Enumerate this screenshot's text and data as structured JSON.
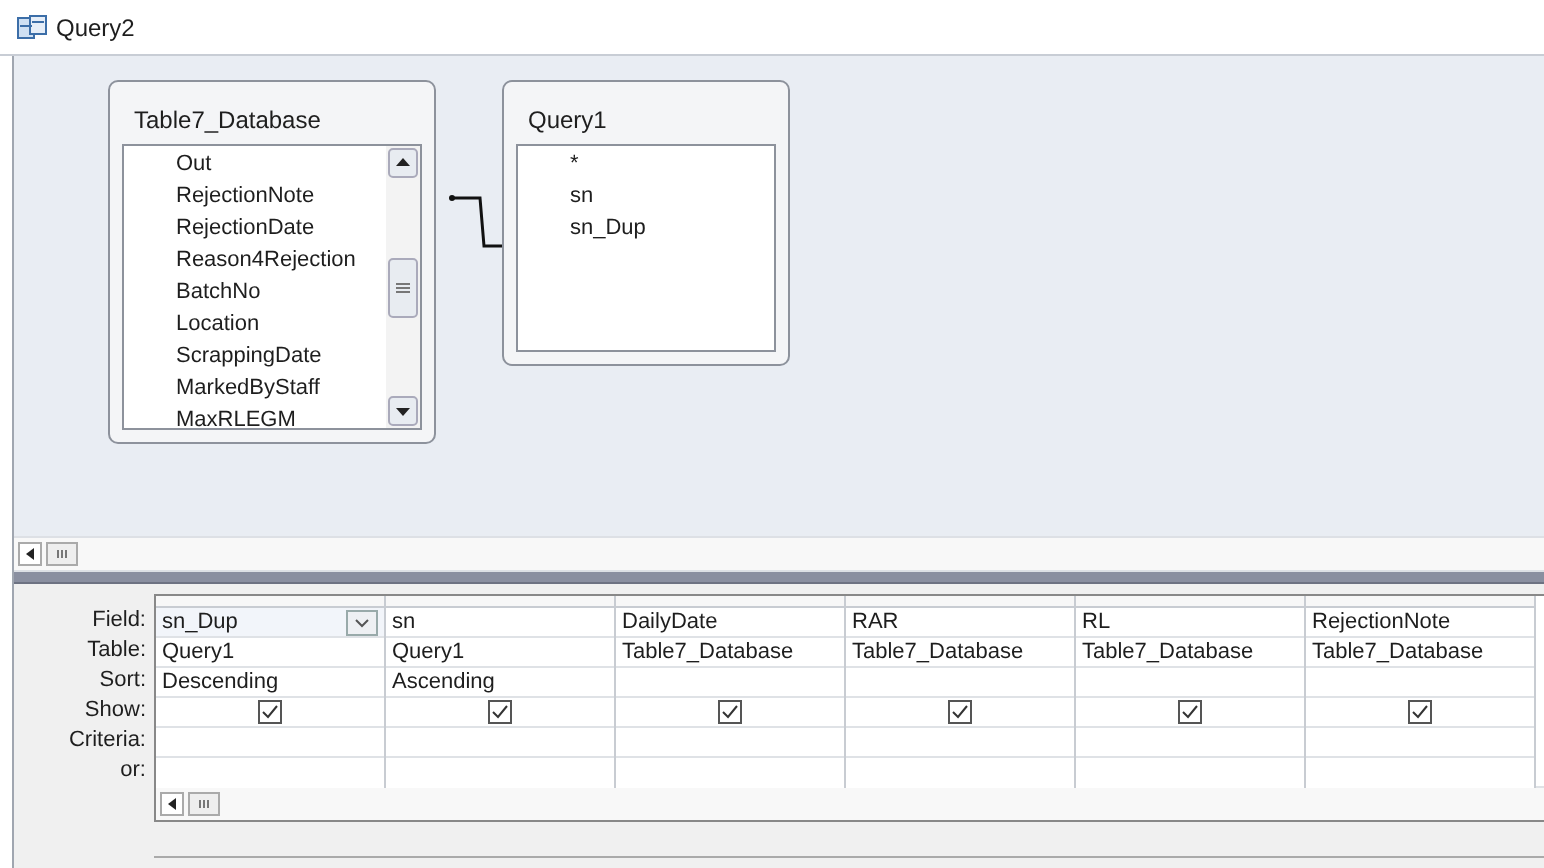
{
  "window": {
    "title": "Query2"
  },
  "tables": [
    {
      "name": "Table7_Database",
      "fields": [
        "Out",
        "RejectionNote",
        "RejectionDate",
        "Reason4Rejection",
        "BatchNo",
        "Location",
        "ScrappingDate",
        "MarkedByStaff",
        "MaxRLEGM"
      ],
      "scrollable": true
    },
    {
      "name": "Query1",
      "fields": [
        "*",
        "sn",
        "sn_Dup"
      ],
      "scrollable": false
    }
  ],
  "grid": {
    "row_labels": [
      "Field:",
      "Table:",
      "Sort:",
      "Show:",
      "Criteria:",
      "or:"
    ],
    "columns": [
      {
        "field": "sn_Dup",
        "table": "Query1",
        "sort": "Descending",
        "show": true,
        "selected": true
      },
      {
        "field": "sn",
        "table": "Query1",
        "sort": "Ascending",
        "show": true,
        "selected": false
      },
      {
        "field": "DailyDate",
        "table": "Table7_Database",
        "show": true,
        "selected": false
      },
      {
        "field": "RAR",
        "table": "Table7_Database",
        "show": true,
        "selected": false
      },
      {
        "field": "RL",
        "table": "Table7_Database",
        "show": true,
        "selected": false
      },
      {
        "field": "RejectionNote",
        "table": "Table7_Database",
        "show": true,
        "selected": false
      }
    ]
  }
}
